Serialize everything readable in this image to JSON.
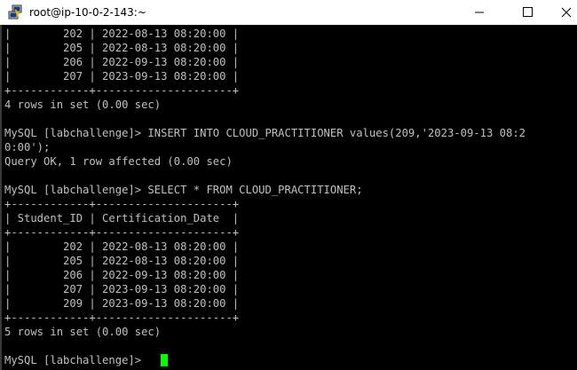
{
  "window": {
    "title": "root@ip-10-0-2-143:~",
    "icon": "putty-icon",
    "controls": [
      "minimize-icon",
      "maximize-icon",
      "close-icon"
    ]
  },
  "terminal": {
    "background": "#000000",
    "text_color": "#c0c0c0",
    "cursor_color": "#00ff00",
    "lines": [
      "|        202 | 2022-08-13 08:20:00 |",
      "|        205 | 2022-08-13 08:20:00 |",
      "|        206 | 2022-09-13 08:20:00 |",
      "|        207 | 2023-09-13 08:20:00 |",
      "+------------+---------------------+",
      "4 rows in set (0.00 sec)",
      "",
      "MySQL [labchallenge]> INSERT INTO CLOUD_PRACTITIONER values(209,'2023-09-13 08:2",
      "0:00');",
      "Query OK, 1 row affected (0.00 sec)",
      "",
      "MySQL [labchallenge]> SELECT * FROM CLOUD_PRACTITIONER;",
      "+------------+---------------------+",
      "| Student_ID | Certification_Date  |",
      "+------------+---------------------+",
      "|        202 | 2022-08-13 08:20:00 |",
      "|        205 | 2022-08-13 08:20:00 |",
      "|        206 | 2022-09-13 08:20:00 |",
      "|        207 | 2023-09-13 08:20:00 |",
      "|        209 | 2023-09-13 08:20:00 |",
      "+------------+---------------------+",
      "5 rows in set (0.00 sec)",
      "",
      "MySQL [labchallenge]> "
    ]
  }
}
